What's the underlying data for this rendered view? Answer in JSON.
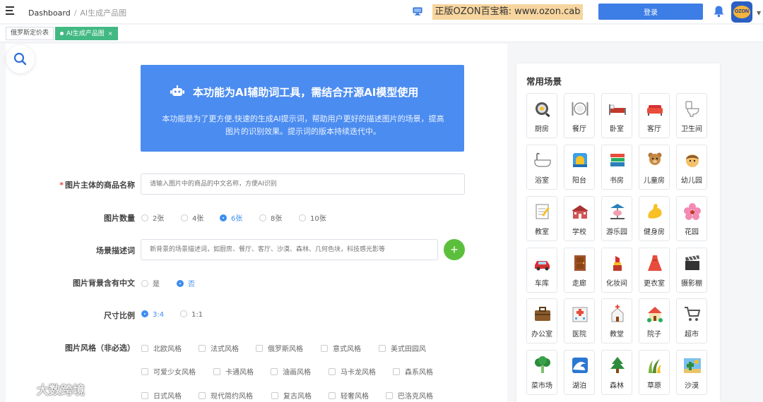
{
  "header": {
    "breadcrumb_home": "Dashboard",
    "breadcrumb_sep": "/",
    "breadcrumb_current": "AI生成产品图",
    "promo": "正版OZON百宝箱: www.ozon.cab",
    "login_label": "登录",
    "avatar_text": "OZON"
  },
  "tabs": [
    {
      "label": "俄罗斯定价表"
    },
    {
      "label": "AI生成产品图",
      "close": "×"
    }
  ],
  "banner": {
    "title": "本功能为AI辅助词工具，需结合开源AI模型使用",
    "desc": "本功能是为了更方便,快速的生成AI提示词，帮助用户更好的描述图片的场景，提高图片的识别效果。提示词的版本持续迭代中。"
  },
  "form": {
    "product_label": "图片主体的商品名称",
    "product_required": "*",
    "product_placeholder": "请输入图片中的商品的中文名称，方便AI识别",
    "count_label": "图片数量",
    "count_options": [
      "2张",
      "4张",
      "6张",
      "8张",
      "10张"
    ],
    "count_selected": "6张",
    "scene_label": "场景描述词",
    "scene_placeholder": "新背景的场景描述词，如厨房、餐厅、客厅、沙漠、森林、几何色块，科技感光影等",
    "add_label": "+",
    "chinese_label": "图片背景含有中文",
    "chinese_options": [
      "是",
      "否"
    ],
    "chinese_selected": "否",
    "ratio_label": "尺寸比例",
    "ratio_options": [
      "3:4",
      "1:1"
    ],
    "ratio_selected": "3:4",
    "style_label": "图片风格（非必选）",
    "style_rows": [
      [
        "北欧风格",
        "法式风格",
        "俄罗斯风格",
        "意式风格",
        "美式田园风"
      ],
      [
        "可爱少女风格",
        "卡通风格",
        "油画风格",
        "马卡龙风格",
        "森系风格"
      ],
      [
        "日式风格",
        "现代简约风格",
        "复古风格",
        "轻奢风格",
        "巴洛克风格"
      ]
    ]
  },
  "scenes": {
    "title": "常用场景",
    "items": [
      {
        "label": "厨房",
        "icon": "frying-pan-icon"
      },
      {
        "label": "餐厅",
        "icon": "plate-cutlery-icon"
      },
      {
        "label": "卧室",
        "icon": "bed-icon"
      },
      {
        "label": "客厅",
        "icon": "sofa-icon"
      },
      {
        "label": "卫生间",
        "icon": "toilet-icon"
      },
      {
        "label": "浴室",
        "icon": "bathtub-icon"
      },
      {
        "label": "阳台",
        "icon": "balcony-icon"
      },
      {
        "label": "书房",
        "icon": "books-icon"
      },
      {
        "label": "儿童房",
        "icon": "teddy-bear-icon"
      },
      {
        "label": "幼儿园",
        "icon": "child-icon"
      },
      {
        "label": "教室",
        "icon": "memo-icon"
      },
      {
        "label": "学校",
        "icon": "school-icon"
      },
      {
        "label": "游乐园",
        "icon": "carousel-icon"
      },
      {
        "label": "健身房",
        "icon": "muscle-icon"
      },
      {
        "label": "花园",
        "icon": "flower-icon"
      },
      {
        "label": "车库",
        "icon": "car-icon"
      },
      {
        "label": "走廊",
        "icon": "door-icon"
      },
      {
        "label": "化妆间",
        "icon": "lipstick-icon"
      },
      {
        "label": "更衣室",
        "icon": "dress-icon"
      },
      {
        "label": "摄影棚",
        "icon": "clapper-icon"
      },
      {
        "label": "办公室",
        "icon": "briefcase-icon"
      },
      {
        "label": "医院",
        "icon": "hospital-icon"
      },
      {
        "label": "教堂",
        "icon": "church-icon"
      },
      {
        "label": "院子",
        "icon": "house-garden-icon"
      },
      {
        "label": "超市",
        "icon": "cart-icon"
      },
      {
        "label": "菜市场",
        "icon": "broccoli-icon"
      },
      {
        "label": "湖泊",
        "icon": "wave-icon"
      },
      {
        "label": "森林",
        "icon": "tree-icon"
      },
      {
        "label": "草原",
        "icon": "grass-icon"
      },
      {
        "label": "沙漠",
        "icon": "desert-icon"
      }
    ]
  },
  "watermark": "大数跨境",
  "colors": {
    "accent": "#3d8ef0",
    "banner": "#4b8cf0",
    "tab_active": "#42b983",
    "add_button": "#5bbf3c",
    "promo_bg": "#f7d59e"
  }
}
